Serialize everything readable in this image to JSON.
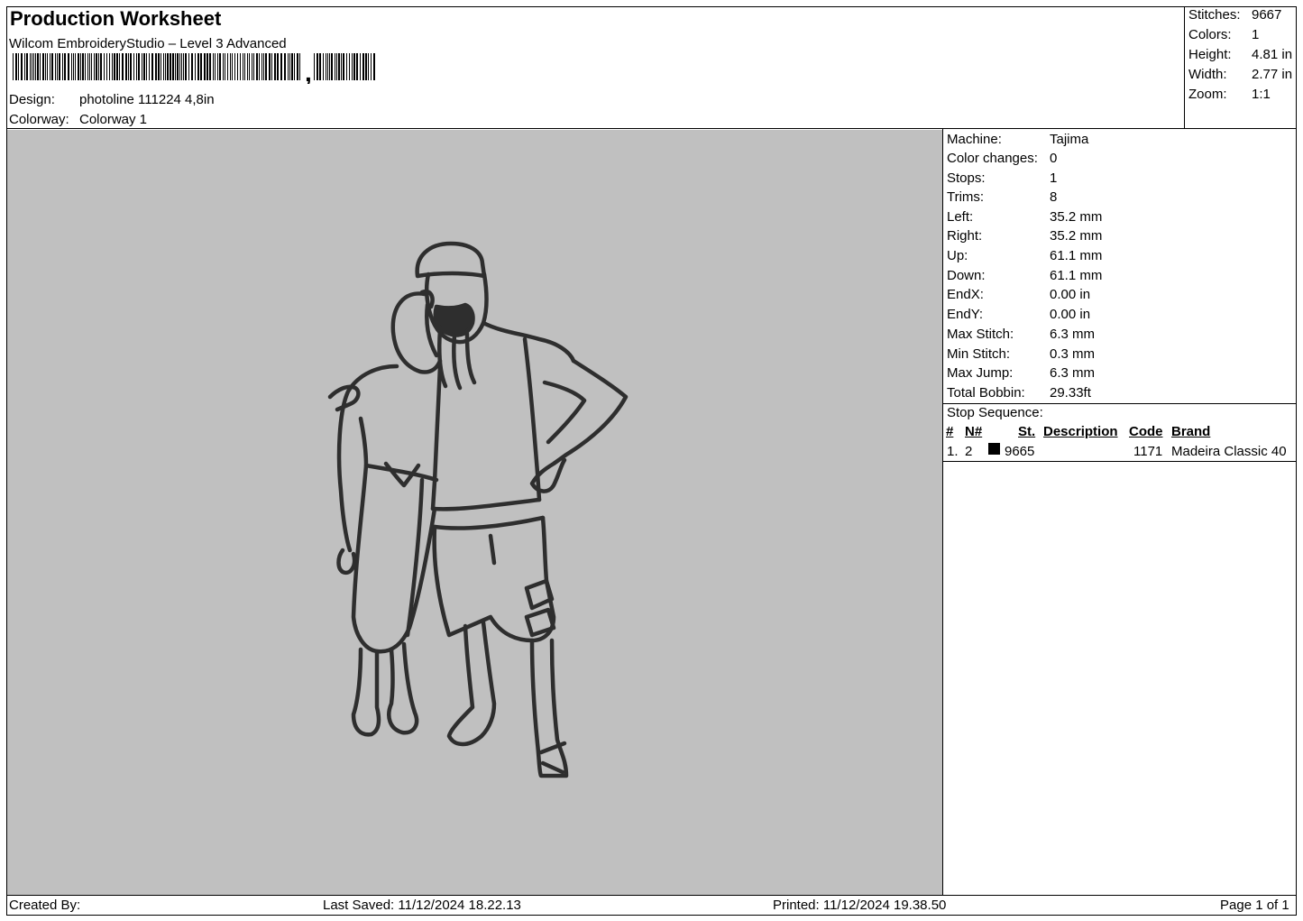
{
  "header": {
    "title": "Production Worksheet",
    "software": "Wilcom EmbroideryStudio – Level 3 Advanced",
    "design_label": "Design:",
    "design_value": "photoline 111224 4,8in",
    "colorway_label": "Colorway:",
    "colorway_value": "Colorway 1"
  },
  "summary": [
    {
      "label": "Stitches:",
      "value": "9667"
    },
    {
      "label": "Colors:",
      "value": "1"
    },
    {
      "label": "Height:",
      "value": "4.81 in"
    },
    {
      "label": "Width:",
      "value": "2.77 in"
    },
    {
      "label": "Zoom:",
      "value": "1:1"
    }
  ],
  "machine": [
    {
      "label": "Machine:",
      "value": "Tajima"
    },
    {
      "label": "Color changes:",
      "value": "0"
    },
    {
      "label": "Stops:",
      "value": "1"
    },
    {
      "label": "Trims:",
      "value": "8"
    },
    {
      "label": "Left:",
      "value": "35.2 mm"
    },
    {
      "label": "Right:",
      "value": "35.2 mm"
    },
    {
      "label": "Up:",
      "value": "61.1 mm"
    },
    {
      "label": "Down:",
      "value": "61.1 mm"
    },
    {
      "label": "EndX:",
      "value": "0.00 in"
    },
    {
      "label": "EndY:",
      "value": "0.00 in"
    },
    {
      "label": "Max Stitch:",
      "value": "6.3 mm"
    },
    {
      "label": "Min Stitch:",
      "value": "0.3 mm"
    },
    {
      "label": "Max Jump:",
      "value": "6.3 mm"
    },
    {
      "label": "Total Bobbin:",
      "value": "29.33ft"
    }
  ],
  "stop_sequence": {
    "title": "Stop Sequence:",
    "columns": {
      "num": "#",
      "n": "N#",
      "st": "St.",
      "description": "Description",
      "code": "Code",
      "brand": "Brand"
    },
    "rows": [
      {
        "num": "1.",
        "n": "2",
        "st": "9665",
        "description": "",
        "code": "1171",
        "brand": "Madeira Classic 40",
        "color": "#000000"
      }
    ]
  },
  "colors": {
    "design_background": "#c0c0c0",
    "thread": "#2e2e2e"
  },
  "footer": {
    "created_by": "Created By:",
    "last_saved": "Last Saved: 11/12/2024 18.22.13",
    "printed": "Printed: 11/12/2024 19.38.50",
    "page": "Page 1 of 1"
  }
}
